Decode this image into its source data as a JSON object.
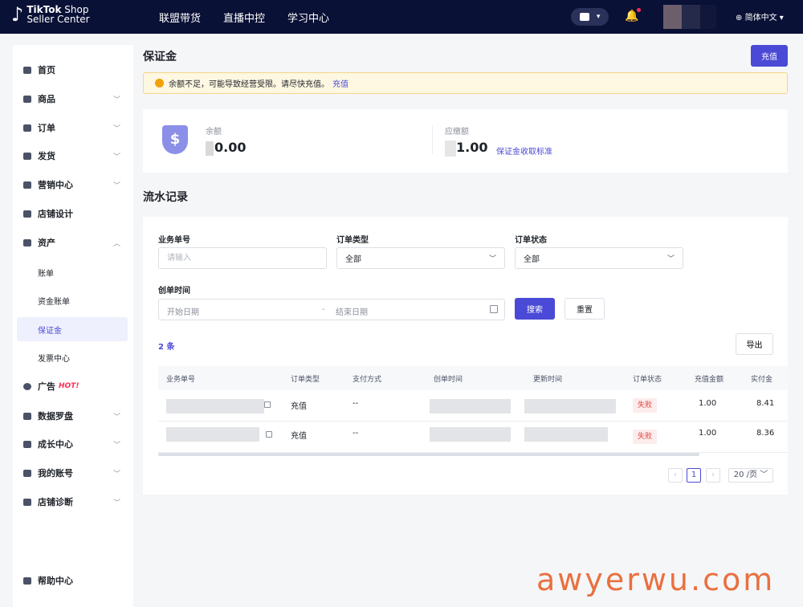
{
  "brand": {
    "line1_bold": "TikTok",
    "line1_rest": " Shop",
    "line2": "Seller Center"
  },
  "topnav": {
    "items": [
      "联盟带货",
      "直播中控",
      "学习中心"
    ]
  },
  "header": {
    "language": "简体中文"
  },
  "sidebar": {
    "items": [
      {
        "label": "首页"
      },
      {
        "label": "商品"
      },
      {
        "label": "订单"
      },
      {
        "label": "发货"
      },
      {
        "label": "营销中心"
      },
      {
        "label": "店铺设计"
      },
      {
        "label": "资产"
      },
      {
        "label": "广告",
        "badge": "HOT!"
      },
      {
        "label": "数据罗盘"
      },
      {
        "label": "成长中心"
      },
      {
        "label": "我的账号"
      },
      {
        "label": "店铺诊断"
      },
      {
        "label": "帮助中心"
      }
    ],
    "asset_sub": [
      "账单",
      "资金账单",
      "保证金",
      "发票中心"
    ]
  },
  "page": {
    "title": "保证金",
    "recharge_label": "充值"
  },
  "notice": {
    "text": "余额不足，可能导致经营受限。请尽快充值。",
    "link": "充值"
  },
  "balance": {
    "label": "余额",
    "value": "0.00",
    "due_label": "应缴额",
    "due_value": "1.00",
    "standard_link": "保证金收取标准"
  },
  "records": {
    "title": "流水记录",
    "filters": {
      "order_no_label": "业务单号",
      "order_no_placeholder": "请输入",
      "order_type_label": "订单类型",
      "order_type_value": "全部",
      "order_status_label": "订单状态",
      "order_status_value": "全部",
      "created_label": "创单时间",
      "start_placeholder": "开始日期",
      "separator": "-",
      "end_placeholder": "结束日期",
      "search_label": "搜索",
      "reset_label": "重置"
    },
    "count": "2 条",
    "export_label": "导出",
    "columns": [
      "业务单号",
      "订单类型",
      "支付方式",
      "创单时间",
      "更新时间",
      "订单状态",
      "充值金额",
      "实付金"
    ],
    "rows": [
      {
        "type": "充值",
        "payment": "--",
        "status": "失败",
        "amount": "1.00",
        "paid": "8.41"
      },
      {
        "type": "充值",
        "payment": "--",
        "status": "失败",
        "amount": "1.00",
        "paid": "8.36"
      }
    ],
    "pagination": {
      "prev": "‹",
      "page": "1",
      "next": "›",
      "page_size": "20 /页"
    }
  },
  "watermark": "awyerwu.com"
}
